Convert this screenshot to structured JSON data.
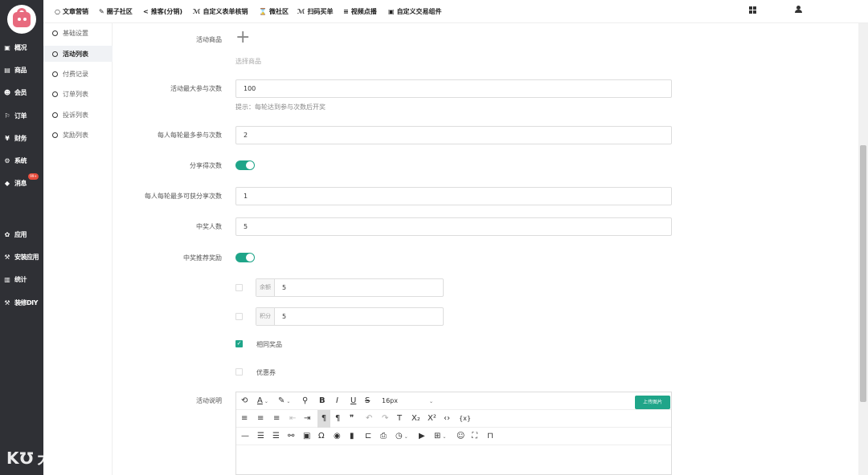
{
  "sidebar": {
    "items": [
      {
        "label": "概况",
        "icon": "dashboard-icon",
        "glyph": "▣"
      },
      {
        "label": "商品",
        "icon": "goods-icon",
        "glyph": "▤"
      },
      {
        "label": "会员",
        "icon": "members-icon",
        "glyph": "☻"
      },
      {
        "label": "订单",
        "icon": "orders-icon",
        "glyph": "⚐"
      },
      {
        "label": "财务",
        "icon": "finance-icon",
        "glyph": "¥"
      },
      {
        "label": "系统",
        "icon": "system-gear-icon",
        "glyph": "⚙"
      },
      {
        "label": "消息",
        "icon": "message-icon",
        "glyph": "◆"
      },
      {
        "label": "应用",
        "icon": "apps-icon",
        "glyph": "✿"
      },
      {
        "label": "安装应用",
        "icon": "install-app-icon",
        "glyph": "⚒"
      },
      {
        "label": "统计",
        "icon": "stats-icon",
        "glyph": "▥"
      },
      {
        "label": "装修DIY",
        "icon": "diy-hammer-icon",
        "glyph": "⚒"
      }
    ],
    "message_badge": "99+"
  },
  "subnav": {
    "items": [
      {
        "label": "基础设置",
        "active": false
      },
      {
        "label": "活动列表",
        "active": true
      },
      {
        "label": "付费记录",
        "active": false
      },
      {
        "label": "订单列表",
        "active": false
      },
      {
        "label": "投诉列表",
        "active": false
      },
      {
        "label": "奖励列表",
        "active": false
      }
    ]
  },
  "topnav": {
    "items": [
      {
        "label": "文章营销",
        "glyph": "○"
      },
      {
        "label": "圈子社区",
        "glyph": "✎"
      },
      {
        "label": "推客(分销)",
        "glyph": "<"
      },
      {
        "label": "自定义表单核销",
        "glyph": "ℳ"
      },
      {
        "label": "微社区",
        "glyph": "⌛"
      },
      {
        "label": "扫码买单",
        "glyph": "ℳ"
      },
      {
        "label": "视频点播",
        "glyph": "≡"
      },
      {
        "label": "自定义交易组件",
        "glyph": "▣"
      }
    ]
  },
  "form": {
    "goods_label": "活动商品",
    "goods_add": "+",
    "goods_hint": "选择商品",
    "max_label": "活动最大参与次数",
    "max_value": "100",
    "max_hint": "提示：每轮达到参与次数后开奖",
    "per_round_label": "每人每轮最多参与次数",
    "per_round_value": "2",
    "share_label": "分享得次数",
    "share_on": true,
    "share_max_label": "每人每轮最多可获分享次数",
    "share_max_value": "1",
    "winners_label": "中奖人数",
    "winners_value": "5",
    "reward_label": "中奖推荐奖励",
    "reward_on": true,
    "balance_label": "余额",
    "balance_value": "5",
    "points_label": "积分",
    "points_value": "5",
    "same_prize_label": "相同奖品",
    "same_prize_checked": true,
    "coupon_label": "优惠券",
    "desc_label": "活动说明"
  },
  "editor": {
    "font_size": "16px",
    "upload_label": "上传图片"
  },
  "colors": {
    "accent": "#1fa589",
    "sidebar": "#2f3035",
    "badge": "#e74c3c"
  }
}
